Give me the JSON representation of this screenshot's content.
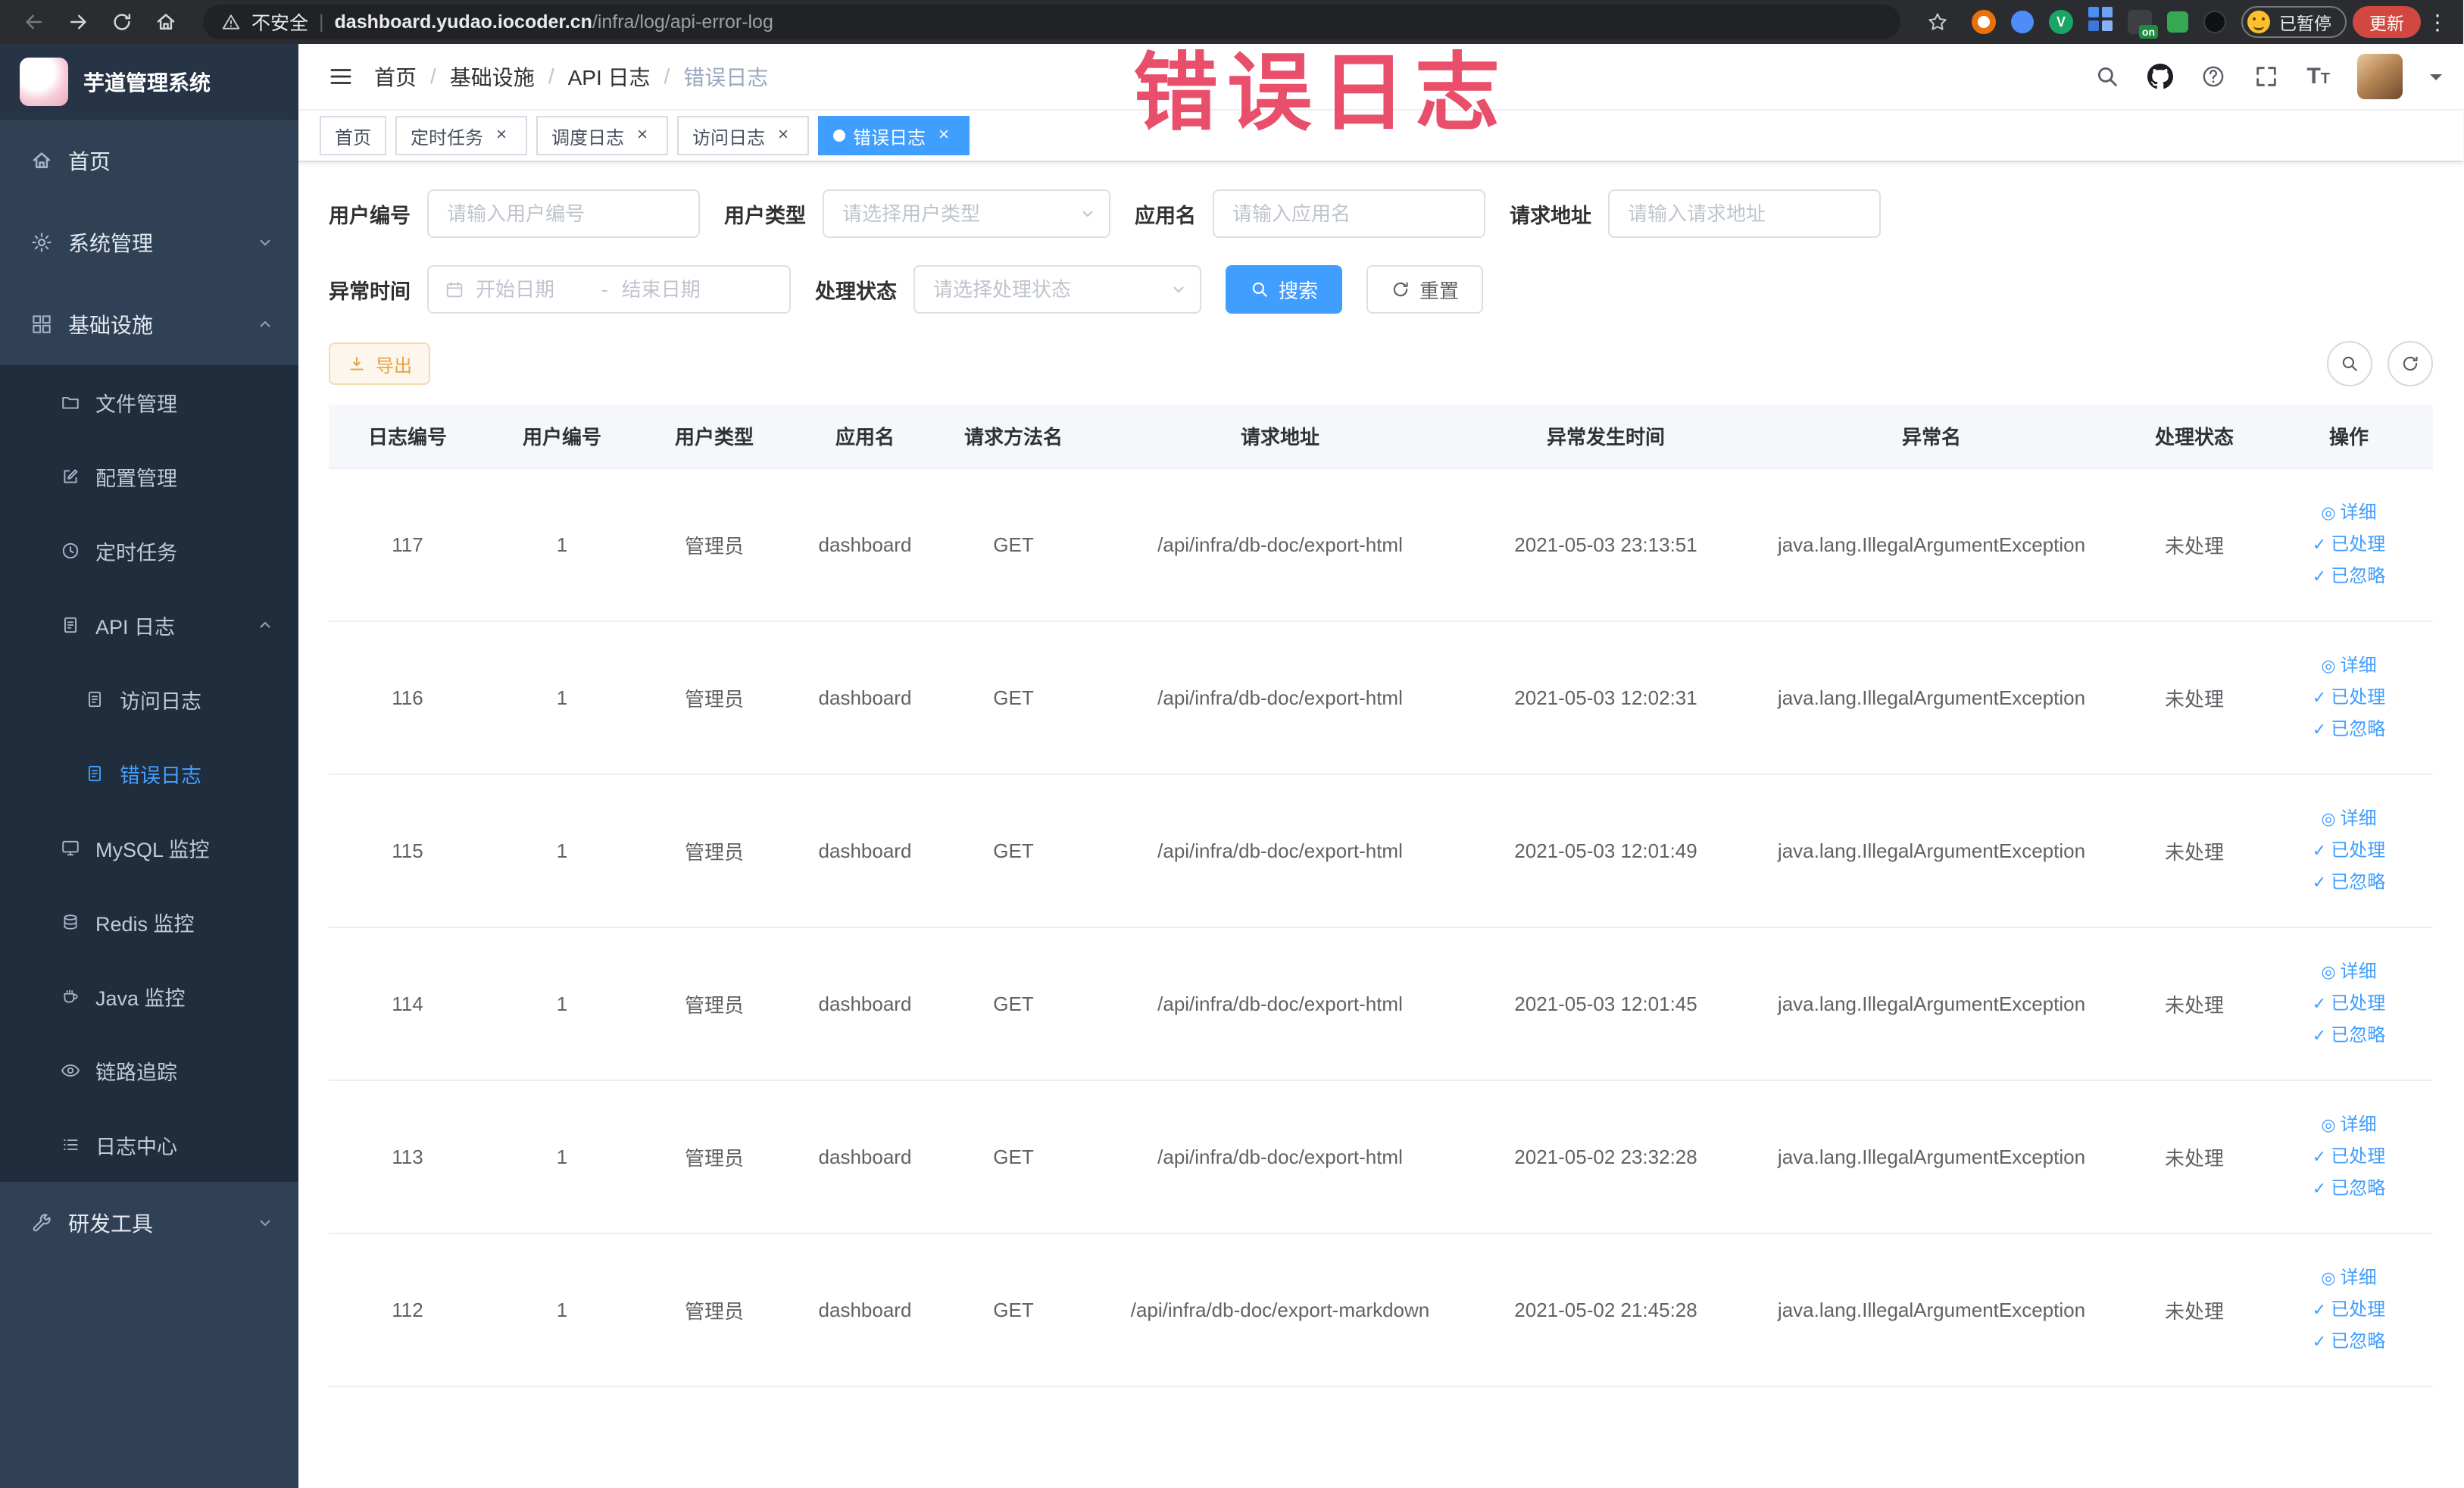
{
  "annotation": {
    "text": "错误日志"
  },
  "browser": {
    "security_label": "不安全",
    "url_domain": "dashboard.yudao.iocoder.cn",
    "url_path": "/infra/log/api-error-log",
    "extension_on_badge": "on",
    "paused_badge": "已暂停",
    "update_button": "更新"
  },
  "sidebar": {
    "title": "芋道管理系统",
    "items": {
      "home": "首页",
      "system": "系统管理",
      "infra": "基础设施",
      "file": "文件管理",
      "config": "配置管理",
      "job": "定时任务",
      "api_log": "API 日志",
      "access_log": "访问日志",
      "error_log": "错误日志",
      "mysql": "MySQL 监控",
      "redis": "Redis 监控",
      "java": "Java 监控",
      "trace": "链路追踪",
      "log_center": "日志中心",
      "dev": "研发工具"
    }
  },
  "header": {
    "breadcrumb": [
      "首页",
      "基础设施",
      "API 日志",
      "错误日志"
    ]
  },
  "tabs": [
    {
      "label": "首页",
      "closable": false,
      "active": false
    },
    {
      "label": "定时任务",
      "closable": true,
      "active": false
    },
    {
      "label": "调度日志",
      "closable": true,
      "active": false
    },
    {
      "label": "访问日志",
      "closable": true,
      "active": false
    },
    {
      "label": "错误日志",
      "closable": true,
      "active": true
    }
  ],
  "filters": {
    "user_id_label": "用户编号",
    "user_id_placeholder": "请输入用户编号",
    "user_type_label": "用户类型",
    "user_type_placeholder": "请选择用户类型",
    "app_label": "应用名",
    "app_placeholder": "请输入应用名",
    "url_label": "请求地址",
    "url_placeholder": "请输入请求地址",
    "time_label": "异常时间",
    "time_start_placeholder": "开始日期",
    "time_separator": "-",
    "time_end_placeholder": "结束日期",
    "status_label": "处理状态",
    "status_placeholder": "请选择处理状态",
    "search_button": "搜索",
    "reset_button": "重置"
  },
  "toolbar": {
    "export_button": "导出"
  },
  "table": {
    "headers": [
      "日志编号",
      "用户编号",
      "用户类型",
      "应用名",
      "请求方法名",
      "请求地址",
      "异常发生时间",
      "异常名",
      "处理状态",
      "操作"
    ],
    "actions": [
      "详细",
      "已处理",
      "已忽略"
    ],
    "rows": [
      {
        "id": "117",
        "user_id": "1",
        "user_type": "管理员",
        "app": "dashboard",
        "method": "GET",
        "url": "/api/infra/db-doc/export-html",
        "time": "2021-05-03 23:13:51",
        "exception": "java.lang.IllegalArgumentException",
        "status": "未处理"
      },
      {
        "id": "116",
        "user_id": "1",
        "user_type": "管理员",
        "app": "dashboard",
        "method": "GET",
        "url": "/api/infra/db-doc/export-html",
        "time": "2021-05-03 12:02:31",
        "exception": "java.lang.IllegalArgumentException",
        "status": "未处理"
      },
      {
        "id": "115",
        "user_id": "1",
        "user_type": "管理员",
        "app": "dashboard",
        "method": "GET",
        "url": "/api/infra/db-doc/export-html",
        "time": "2021-05-03 12:01:49",
        "exception": "java.lang.IllegalArgumentException",
        "status": "未处理"
      },
      {
        "id": "114",
        "user_id": "1",
        "user_type": "管理员",
        "app": "dashboard",
        "method": "GET",
        "url": "/api/infra/db-doc/export-html",
        "time": "2021-05-03 12:01:45",
        "exception": "java.lang.IllegalArgumentException",
        "status": "未处理"
      },
      {
        "id": "113",
        "user_id": "1",
        "user_type": "管理员",
        "app": "dashboard",
        "method": "GET",
        "url": "/api/infra/db-doc/export-html",
        "time": "2021-05-02 23:32:28",
        "exception": "java.lang.IllegalArgumentException",
        "status": "未处理"
      },
      {
        "id": "112",
        "user_id": "1",
        "user_type": "管理员",
        "app": "dashboard",
        "method": "GET",
        "url": "/api/infra/db-doc/export-markdown",
        "time": "2021-05-02 21:45:28",
        "exception": "java.lang.IllegalArgumentException",
        "status": "未处理"
      }
    ]
  },
  "colors": {
    "primary": "#409EFF",
    "warning": "#e6a23c",
    "annotation": "#e8405e",
    "sidebar_bg": "#304156",
    "submenu_bg": "#1f2d3d"
  }
}
